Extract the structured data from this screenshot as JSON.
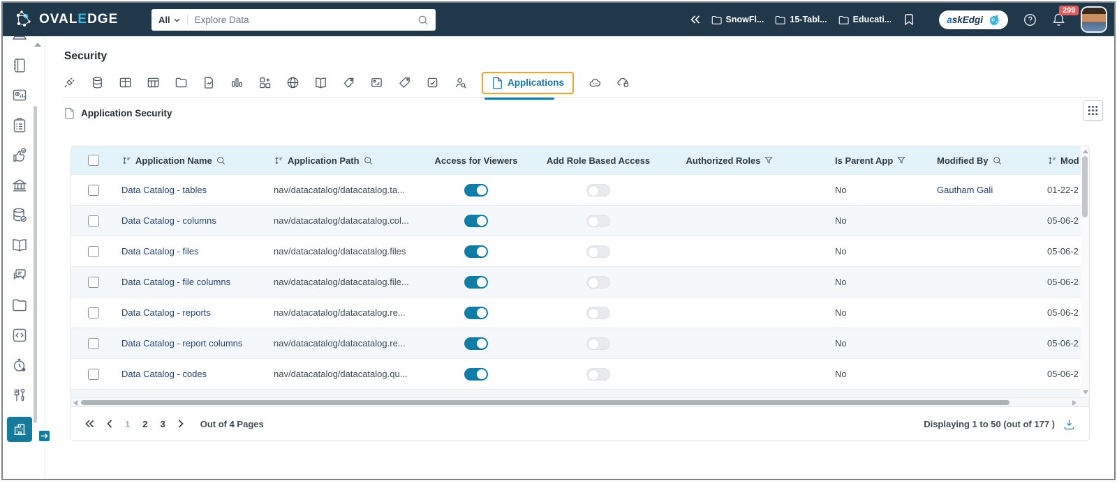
{
  "colors": {
    "header_bg": "#20384a",
    "accent_cyan": "#35b8e0",
    "teal": "#0f7da6",
    "tab_highlight_orange": "#f0a12f",
    "active_link_blue": "#1577a8",
    "table_header_bg": "#e4f3f9",
    "badge_red": "#e25d5d"
  },
  "header": {
    "brand": {
      "oval": "OVAL",
      "e": "E",
      "dge": "DGE"
    },
    "search": {
      "scope": "All",
      "placeholder": "Explore Data"
    },
    "recent_items": [
      "SnowFl...",
      "15-Tabl...",
      "Educati..."
    ],
    "ask_edgi_label": "askEdgi",
    "notification_count": "299",
    "icons": [
      "collapse-chevrons-icon",
      "folder-icon",
      "bookmark-icon",
      "help-icon",
      "bell-icon",
      "avatar"
    ]
  },
  "sidebar": {
    "icons": [
      "laptop-icon",
      "notebook-icon",
      "monitor-chart-icon",
      "clipboard-icon",
      "certification-icon",
      "governance-icon",
      "data-quality-icon",
      "glossary-icon",
      "collaboration-icon",
      "projects-icon",
      "query-sheet-icon",
      "jobs-icon",
      "tools-icon",
      "administration-icon"
    ],
    "selected_icon": "administration-icon"
  },
  "page": {
    "title": "Security",
    "active_tab_label": "Applications",
    "tab_icons": [
      "connector-icon",
      "database-icon",
      "table-icon",
      "table-columns-icon",
      "folder-icon",
      "file-query-icon",
      "report-icon",
      "report-columns-icon",
      "globe-icon",
      "codes-book-icon",
      "tag-badge-icon",
      "image-chart-icon",
      "tag-icon",
      "checkbox-icon",
      "user-search-icon",
      "applications-file-icon",
      "cloud-api-icon",
      "cloud-lock-icon"
    ],
    "section_title": "Application Security"
  },
  "table": {
    "columns": [
      {
        "label": ""
      },
      {
        "label": "Application Name",
        "icons": [
          "sort-icon",
          "search-icon"
        ]
      },
      {
        "label": "Application Path",
        "icons": [
          "sort-icon",
          "search-icon"
        ]
      },
      {
        "label": "Access for Viewers",
        "icons": []
      },
      {
        "label": "Add Role Based Access",
        "icons": []
      },
      {
        "label": "Authorized Roles",
        "icons": [
          "filter-icon"
        ]
      },
      {
        "label": "Is Parent App",
        "icons": [
          "filter-icon"
        ]
      },
      {
        "label": "Modified By",
        "icons": [
          "search-icon"
        ]
      },
      {
        "label": "Mod",
        "icons": [
          "sort-icon"
        ]
      }
    ],
    "rows": [
      {
        "name": "Data Catalog - tables",
        "path": "nav/datacatalog/datacatalog.ta...",
        "viewers_on": true,
        "role_access_on": false,
        "authorized_roles": "",
        "is_parent": "No",
        "modified_by": "Gautham Gali",
        "modified_date": "01-22-2"
      },
      {
        "name": "Data Catalog - columns",
        "path": "nav/datacatalog/datacatalog.col...",
        "viewers_on": true,
        "role_access_on": false,
        "authorized_roles": "",
        "is_parent": "No",
        "modified_by": "",
        "modified_date": "05-06-2"
      },
      {
        "name": "Data Catalog - files",
        "path": "nav/datacatalog/datacatalog.files",
        "viewers_on": true,
        "role_access_on": false,
        "authorized_roles": "",
        "is_parent": "No",
        "modified_by": "",
        "modified_date": "05-06-2"
      },
      {
        "name": "Data Catalog - file columns",
        "path": "nav/datacatalog/datacatalog.file...",
        "viewers_on": true,
        "role_access_on": false,
        "authorized_roles": "",
        "is_parent": "No",
        "modified_by": "",
        "modified_date": "05-06-2"
      },
      {
        "name": "Data Catalog - reports",
        "path": "nav/datacatalog/datacatalog.re...",
        "viewers_on": true,
        "role_access_on": false,
        "authorized_roles": "",
        "is_parent": "No",
        "modified_by": "",
        "modified_date": "05-06-2"
      },
      {
        "name": "Data Catalog - report columns",
        "path": "nav/datacatalog/datacatalog.re...",
        "viewers_on": true,
        "role_access_on": false,
        "authorized_roles": "",
        "is_parent": "No",
        "modified_by": "",
        "modified_date": "05-06-2"
      },
      {
        "name": "Data Catalog - codes",
        "path": "nav/datacatalog/datacatalog.qu...",
        "viewers_on": true,
        "role_access_on": false,
        "authorized_roles": "",
        "is_parent": "No",
        "modified_by": "",
        "modified_date": "05-06-2"
      }
    ]
  },
  "pagination": {
    "pages": [
      "1",
      "2",
      "3"
    ],
    "current_page": "1",
    "out_of_label": "Out of 4 Pages",
    "displaying_label": "Displaying 1 to 50  (out of 177 )"
  }
}
